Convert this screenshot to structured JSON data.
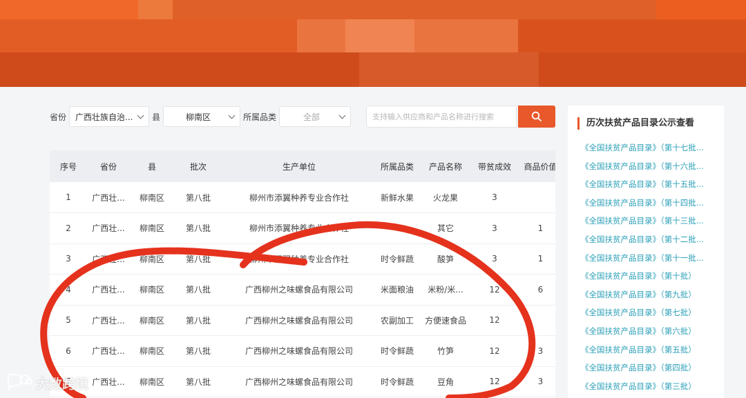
{
  "filters": {
    "province_label": "省份",
    "province_value": "广西壮族自治...",
    "county_label": "县",
    "county_value": "柳南区",
    "category_label": "所属品类",
    "category_value": "全部",
    "search_placeholder": "支持输入供应商和产品名称进行搜索"
  },
  "table": {
    "headers": [
      "序号",
      "省份",
      "县",
      "批次",
      "生产单位",
      "所属品类",
      "产品名称",
      "带贫成效",
      "商品价值"
    ],
    "rows": [
      [
        "1",
        "广西壮...",
        "柳南区",
        "第八批",
        "柳州市添翼种养专业合作社",
        "新鲜水果",
        "火龙果",
        "3",
        ""
      ],
      [
        "2",
        "广西壮...",
        "柳南区",
        "第八批",
        "柳州市添翼种养专业合作社",
        "",
        "其它",
        "3",
        "1"
      ],
      [
        "3",
        "广西壮...",
        "柳南区",
        "第八批",
        "柳州市添翼种养专业合作社",
        "时令鲜蔬",
        "酸笋",
        "3",
        "1"
      ],
      [
        "4",
        "广西壮...",
        "柳南区",
        "第八批",
        "广西柳州之味螺食品有限公司",
        "米面粮油",
        "米粉/米...",
        "12",
        "6"
      ],
      [
        "5",
        "广西壮...",
        "柳南区",
        "第八批",
        "广西柳州之味螺食品有限公司",
        "农副加工",
        "方便速食品",
        "12",
        ""
      ],
      [
        "6",
        "广西壮...",
        "柳南区",
        "第八批",
        "广西柳州之味螺食品有限公司",
        "时令鲜蔬",
        "竹笋",
        "12",
        "3"
      ],
      [
        "7",
        "广西壮...",
        "柳南区",
        "第八批",
        "广西柳州之味螺食品有限公司",
        "时令鲜蔬",
        "豆角",
        "12",
        "3"
      ]
    ]
  },
  "sidebar": {
    "title": "历次扶贫产品目录公示查看",
    "items": [
      "《全国扶贫产品目录》（第十七批...",
      "《全国扶贫产品目录》（第十六批...",
      "《全国扶贫产品目录》（第十五批...",
      "《全国扶贫产品目录》（第十四批...",
      "《全国扶贫产品目录》（第十三批...",
      "《全国扶贫产品目录》（第十二批...",
      "《全国扶贫产品目录》（第十一批...",
      "《全国扶贫产品目录》（第十批）",
      "《全国扶贫产品目录》（第九批）",
      "《全国扶贫产品目录》（第七批）",
      "《全国扶贫产品目录》（第六批）",
      "《全国扶贫产品目录》（第五批）",
      "《全国扶贫产品目录》（第四批）",
      "《全国扶贫产品目录》（第三批）"
    ]
  },
  "watermark": {
    "text": "大数跨境",
    "icon": "chat-bubble-logo-icon"
  },
  "colors": {
    "accent": "#e8582a",
    "link": "#2a9fb8",
    "annotation": "#e5321d",
    "banner": "#d9501c"
  }
}
